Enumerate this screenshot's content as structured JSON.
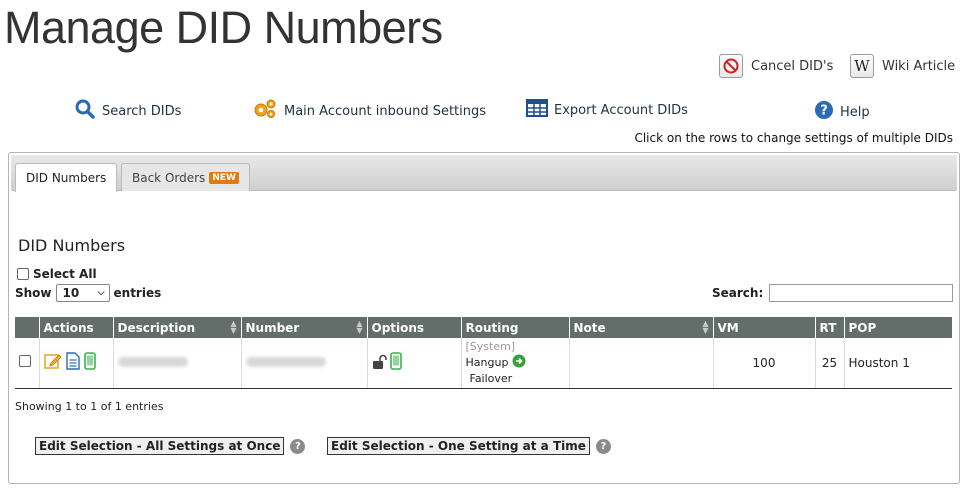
{
  "title": "Manage DID Numbers",
  "top_actions": {
    "cancel_label": "Cancel DID's",
    "wiki_label": "Wiki Article"
  },
  "nav": {
    "search_label": "Search DIDs",
    "main_settings_label": "Main Account inbound Settings",
    "export_label": "Export Account DIDs",
    "help_label": "Help"
  },
  "hint": "Click on the rows to change settings of multiple DIDs",
  "tabs": [
    {
      "label": "DID Numbers",
      "active": true
    },
    {
      "label": "Back Orders",
      "badge": "NEW",
      "active": false
    }
  ],
  "section_title": "DID Numbers",
  "select_all_label": "Select All",
  "show": {
    "prefix": "Show",
    "value": "10",
    "suffix": "entries"
  },
  "search_label": "Search:",
  "table": {
    "headers": [
      "Actions",
      "Description",
      "Number",
      "Options",
      "Routing",
      "Note",
      "VM",
      "RT",
      "POP"
    ],
    "rows": [
      {
        "routing_system": "[System]",
        "routing_action": "Hangup",
        "routing_failover": "Failover",
        "note": "",
        "vm": "100",
        "rt": "25",
        "pop": "Houston 1"
      }
    ]
  },
  "footer_info": "Showing 1 to 1 of 1 entries",
  "edit_all_label": "Edit Selection - All Settings at Once",
  "edit_one_label": "Edit Selection - One Setting at a Time",
  "colors": {
    "header_bg": "#636e6b",
    "link_blue": "#2a6bb4",
    "badge_orange": "#e47b12",
    "cancel_red": "#d0201e"
  }
}
